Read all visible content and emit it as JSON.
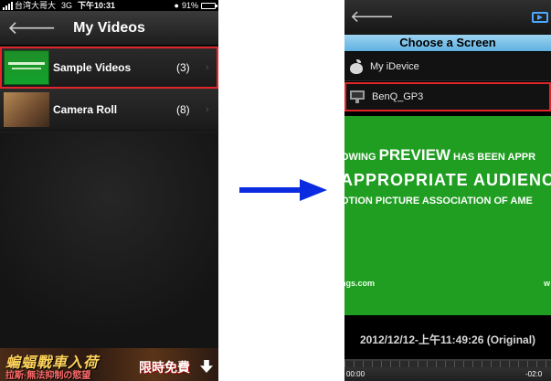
{
  "left_phone": {
    "status": {
      "carrier": "台湾大哥大",
      "network": "3G",
      "time": "下午10:31",
      "battery": "91%",
      "battery_level": 0.91
    },
    "nav": {
      "back_icon": "back-arrow-icon",
      "title": "My Videos"
    },
    "rows": [
      {
        "label": "Sample Videos",
        "count": "(3)",
        "selected": true
      },
      {
        "label": "Camera Roll",
        "count": "(8)",
        "selected": false
      }
    ],
    "ad": {
      "main": "蝙蝠戰車入荷",
      "sub": "拉斯·無法抑制の慾望",
      "cta": "限時免費"
    }
  },
  "right_phone": {
    "nav": {
      "back_icon": "back-arrow-icon",
      "action_icon": "screen-icon"
    },
    "choose_header": "Choose a Screen",
    "devices": [
      {
        "label": "My iDevice",
        "icon": "apple-icon"
      },
      {
        "label": "BenQ_GP3",
        "icon": "monitor-icon",
        "selected": true
      }
    ],
    "video": {
      "line1_small": "OWING",
      "line1_big": "PREVIEW",
      "line1_rest": "HAS BEEN APPR",
      "line2": "APPROPRIATE AUDIENCES",
      "line3": "OTION PICTURE ASSOCIATION OF AME",
      "link_left": "ngs.com",
      "link_right": "w"
    },
    "caption": "2012/12/12-上午11:49:26 (Original)",
    "player": {
      "time_start": "00:00",
      "time_end": "-02:0"
    }
  },
  "colors": {
    "highlight": "#e0262b",
    "video_green": "#1f9e21",
    "header_blue": "#5fb2e0",
    "arrow_blue": "#0a2be0"
  }
}
